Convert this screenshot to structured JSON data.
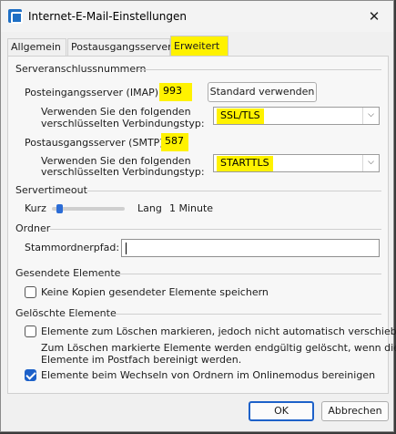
{
  "window": {
    "title": "Internet-E-Mail-Einstellungen",
    "close_glyph": "✕"
  },
  "tabs": [
    {
      "label": "Allgemein",
      "active": false
    },
    {
      "label": "Postausgangsserver",
      "active": false
    },
    {
      "label": "Erweitert",
      "active": true
    }
  ],
  "server_ports": {
    "group_label": "Serveranschlussnummern",
    "incoming_label": "Posteingangsserver (IMAP):",
    "incoming_value": "993",
    "standard_button": "Standard verwenden",
    "incoming_encryption_label_1": "Verwenden Sie den folgenden",
    "incoming_encryption_label_2": "verschlüsselten Verbindungstyp:",
    "incoming_encryption_value": "SSL/TLS",
    "outgoing_label": "Postausgangsserver (SMTP):",
    "outgoing_value": "587",
    "outgoing_encryption_label_1": "Verwenden Sie den folgenden",
    "outgoing_encryption_label_2": "verschlüsselten Verbindungstyp:",
    "outgoing_encryption_value": "STARTTLS"
  },
  "timeout": {
    "group_label": "Servertimeout",
    "short_label": "Kurz",
    "long_label": "Lang",
    "value_text": "1 Minute",
    "slider_level": 0.1
  },
  "folders": {
    "group_label": "Ordner",
    "root_label": "Stammordnerpfad:",
    "root_value": ""
  },
  "sent_items": {
    "group_label": "Gesendete Elemente",
    "no_copies_label": "Keine Kopien gesendeter Elemente speichern",
    "no_copies_checked": false
  },
  "deleted_items": {
    "group_label": "Gelöschte Elemente",
    "mark_label": "Elemente zum Löschen markieren, jedoch nicht automatisch verschieben",
    "mark_checked": false,
    "note_line_1": "Zum Löschen markierte Elemente werden endgültig gelöscht, wenn die",
    "note_line_2": "Elemente im Postfach bereinigt werden.",
    "purge_label": "Elemente beim Wechseln von Ordnern im Onlinemodus bereinigen",
    "purge_checked": true
  },
  "footer": {
    "ok_label": "OK",
    "cancel_label": "Abbrechen"
  },
  "colors": {
    "highlight": "#fff200",
    "accent": "#1d61c9"
  }
}
